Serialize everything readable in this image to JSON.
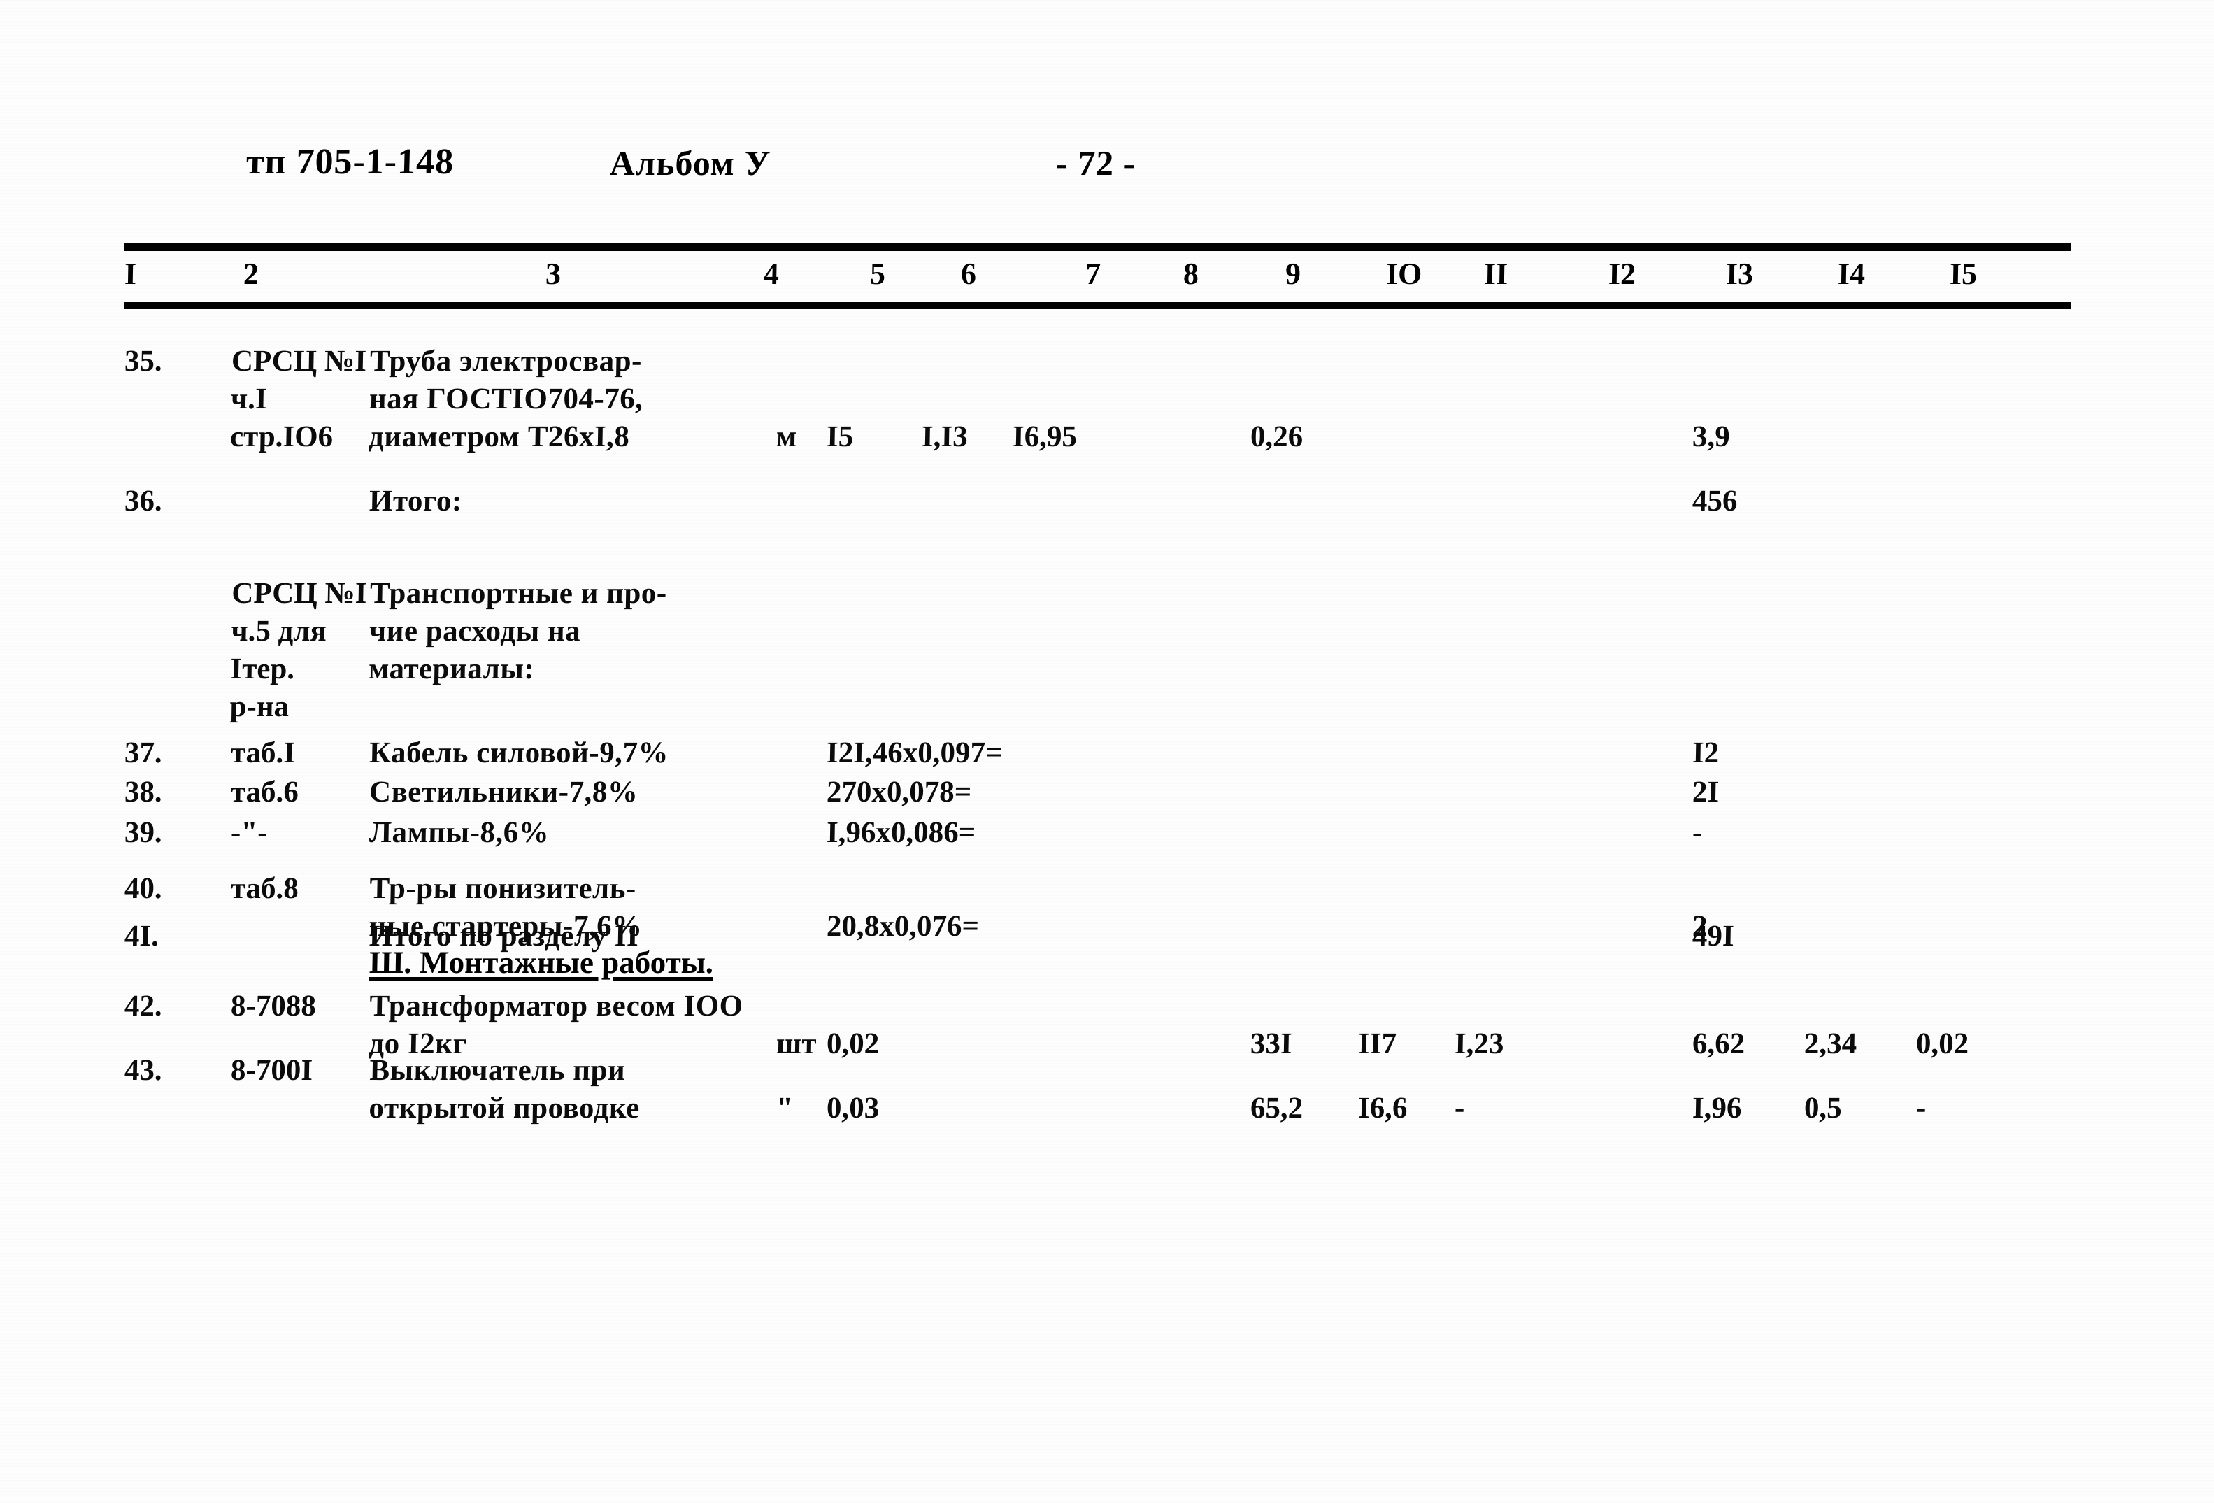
{
  "header": {
    "doc_code": "тп 705-1-148",
    "album": "Альбом У",
    "page_number": "- 72 -"
  },
  "table": {
    "column_numbers": [
      "I",
      "2",
      "3",
      "4",
      "5",
      "6",
      "7",
      "8",
      "9",
      "IO",
      "II",
      "I2",
      "I3",
      "I4",
      "I5"
    ],
    "rows": [
      {
        "no": "35.",
        "code": "СРСЦ №I\nч.I\nстр.IO6",
        "desc": "Труба электросвар-\nная ГОСТIO704-76,\nдиаметром T26xI,8",
        "unit": "м",
        "c5": "I5",
        "c6": "I,I3",
        "c7": "I6,95",
        "c8": "",
        "c9": "0,26",
        "c10": "",
        "c11": "",
        "c12": "",
        "c13": "3,9",
        "c14": "",
        "c15": ""
      },
      {
        "no": "36.",
        "code": "",
        "desc": "Итого:",
        "unit": "",
        "c5": "",
        "c6": "",
        "c7": "",
        "c8": "",
        "c9": "",
        "c10": "",
        "c11": "",
        "c12": "",
        "c13": "456",
        "c14": "",
        "c15": ""
      },
      {
        "no": "",
        "code": "СРСЦ №I\nч.5 для\nIтер.\nр-на",
        "desc": "Транспортные и про-\nчие расходы на\nматериалы:",
        "unit": "",
        "c5": "",
        "c6": "",
        "c7": "",
        "c8": "",
        "c9": "",
        "c10": "",
        "c11": "",
        "c12": "",
        "c13": "",
        "c14": "",
        "c15": ""
      },
      {
        "no": "37.",
        "code": "таб.I",
        "desc": "Кабель силовой-9,7%",
        "unit": "",
        "c5": "I2I,46x0,097=",
        "c6": "",
        "c7": "",
        "c8": "",
        "c9": "",
        "c10": "",
        "c11": "",
        "c12": "",
        "c13": "I2",
        "c14": "",
        "c15": ""
      },
      {
        "no": "38.",
        "code": "таб.6",
        "desc": "Светильники-7,8%",
        "unit": "",
        "c5": "270x0,078=",
        "c6": "",
        "c7": "",
        "c8": "",
        "c9": "",
        "c10": "",
        "c11": "",
        "c12": "",
        "c13": "2I",
        "c14": "",
        "c15": ""
      },
      {
        "no": "39.",
        "code": "-\"-",
        "desc": "Лампы-8,6%",
        "unit": "",
        "c5": "I,96x0,086=",
        "c6": "",
        "c7": "",
        "c8": "",
        "c9": "",
        "c10": "",
        "c11": "",
        "c12": "",
        "c13": "-",
        "c14": "",
        "c15": ""
      },
      {
        "no": "40.",
        "code": "таб.8",
        "desc": "Тр-ры понизитель-\nные,стартеры-7,6%",
        "unit": "",
        "c5": "20,8x0,076=",
        "c6": "",
        "c7": "",
        "c8": "",
        "c9": "",
        "c10": "",
        "c11": "",
        "c12": "",
        "c13": "2",
        "c14": "",
        "c15": ""
      },
      {
        "no": "4I.",
        "code": "",
        "desc": "Итого по разделу II",
        "unit": "",
        "c5": "",
        "c6": "",
        "c7": "",
        "c8": "",
        "c9": "",
        "c10": "",
        "c11": "",
        "c12": "",
        "c13": "49I",
        "c14": "",
        "c15": ""
      },
      {
        "no": "42.",
        "code": "8-7088",
        "desc": "Трансформатор весом IOO\nдо I2кг",
        "unit": "шт",
        "c5": "0,02",
        "c6": "",
        "c7": "",
        "c8": "",
        "c9": "33I",
        "c10": "II7",
        "c11": "I,23",
        "c12": "",
        "c13": "6,62",
        "c14": "2,34",
        "c15": "0,02"
      },
      {
        "no": "43.",
        "code": "8-700I",
        "desc": "Выключатель при\nоткрытой проводке",
        "unit": "\"",
        "c5": "0,03",
        "c6": "",
        "c7": "",
        "c8": "",
        "c9": "65,2",
        "c10": "I6,6",
        "c11": "-",
        "c12": "",
        "c13": "I,96",
        "c14": "0,5",
        "c15": "-"
      }
    ],
    "section_heading": "Ш. Монтажные работы."
  }
}
